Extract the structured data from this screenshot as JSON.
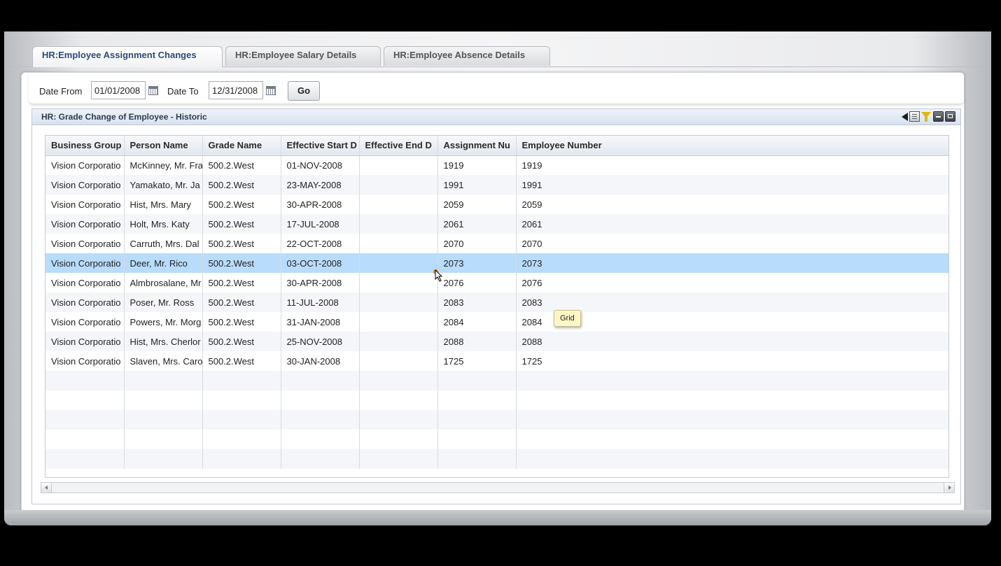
{
  "tabs": [
    {
      "label": "HR:Employee Assignment Changes",
      "active": true
    },
    {
      "label": "HR:Employee Salary Details",
      "active": false
    },
    {
      "label": "HR:Employee Absence Details",
      "active": false
    }
  ],
  "filter": {
    "date_from_label": "Date From",
    "date_from_value": "01/01/2008",
    "date_to_label": "Date To",
    "date_to_value": "12/31/2008",
    "go_label": "Go"
  },
  "panel": {
    "title": "HR: Grade Change of Employee - Historic",
    "icons": [
      "collapse-icon",
      "export-icon",
      "filter-icon",
      "minimize-icon",
      "maximize-icon"
    ]
  },
  "grid": {
    "columns": [
      "Business Group",
      "Person Name",
      "Grade Name",
      "Effective Start D",
      "Effective End D",
      "Assignment Nu",
      "Employee Number"
    ],
    "rows": [
      [
        "Vision Corporatio",
        "McKinney, Mr. Fra",
        "500.2.West",
        "01-NOV-2008",
        "",
        "1919",
        "1919"
      ],
      [
        "Vision Corporatio",
        "Yamakato, Mr. Ja",
        "500.2.West",
        "23-MAY-2008",
        "",
        "1991",
        "1991"
      ],
      [
        "Vision Corporatio",
        "Hist, Mrs. Mary",
        "500.2.West",
        "30-APR-2008",
        "",
        "2059",
        "2059"
      ],
      [
        "Vision Corporatio",
        "Holt, Mrs. Katy",
        "500.2.West",
        "17-JUL-2008",
        "",
        "2061",
        "2061"
      ],
      [
        "Vision Corporatio",
        "Carruth, Mrs. Dal",
        "500.2.West",
        "22-OCT-2008",
        "",
        "2070",
        "2070"
      ],
      [
        "Vision Corporatio",
        "Deer, Mr. Rico",
        "500.2.West",
        "03-OCT-2008",
        "",
        "2073",
        "2073"
      ],
      [
        "Vision Corporatio",
        "Almbrosalane, Mr",
        "500.2.West",
        "30-APR-2008",
        "",
        "2076",
        "2076"
      ],
      [
        "Vision Corporatio",
        "Poser, Mr. Ross",
        "500.2.West",
        "11-JUL-2008",
        "",
        "2083",
        "2083"
      ],
      [
        "Vision Corporatio",
        "Powers, Mr. Morg",
        "500.2.West",
        "31-JAN-2008",
        "",
        "2084",
        "2084"
      ],
      [
        "Vision Corporatio",
        "Hist, Mrs. Cherlor",
        "500.2.West",
        "25-NOV-2008",
        "",
        "2088",
        "2088"
      ],
      [
        "Vision Corporatio",
        "Slaven, Mrs. Caro",
        "500.2.West",
        "30-JAN-2008",
        "",
        "1725",
        "1725"
      ]
    ],
    "selected_row": 5,
    "empty_rows": 5
  },
  "tooltip": {
    "text": "Grid"
  },
  "colors": {
    "selected_row": "#b8dcfb",
    "active_tab_text": "#2b4a78"
  }
}
